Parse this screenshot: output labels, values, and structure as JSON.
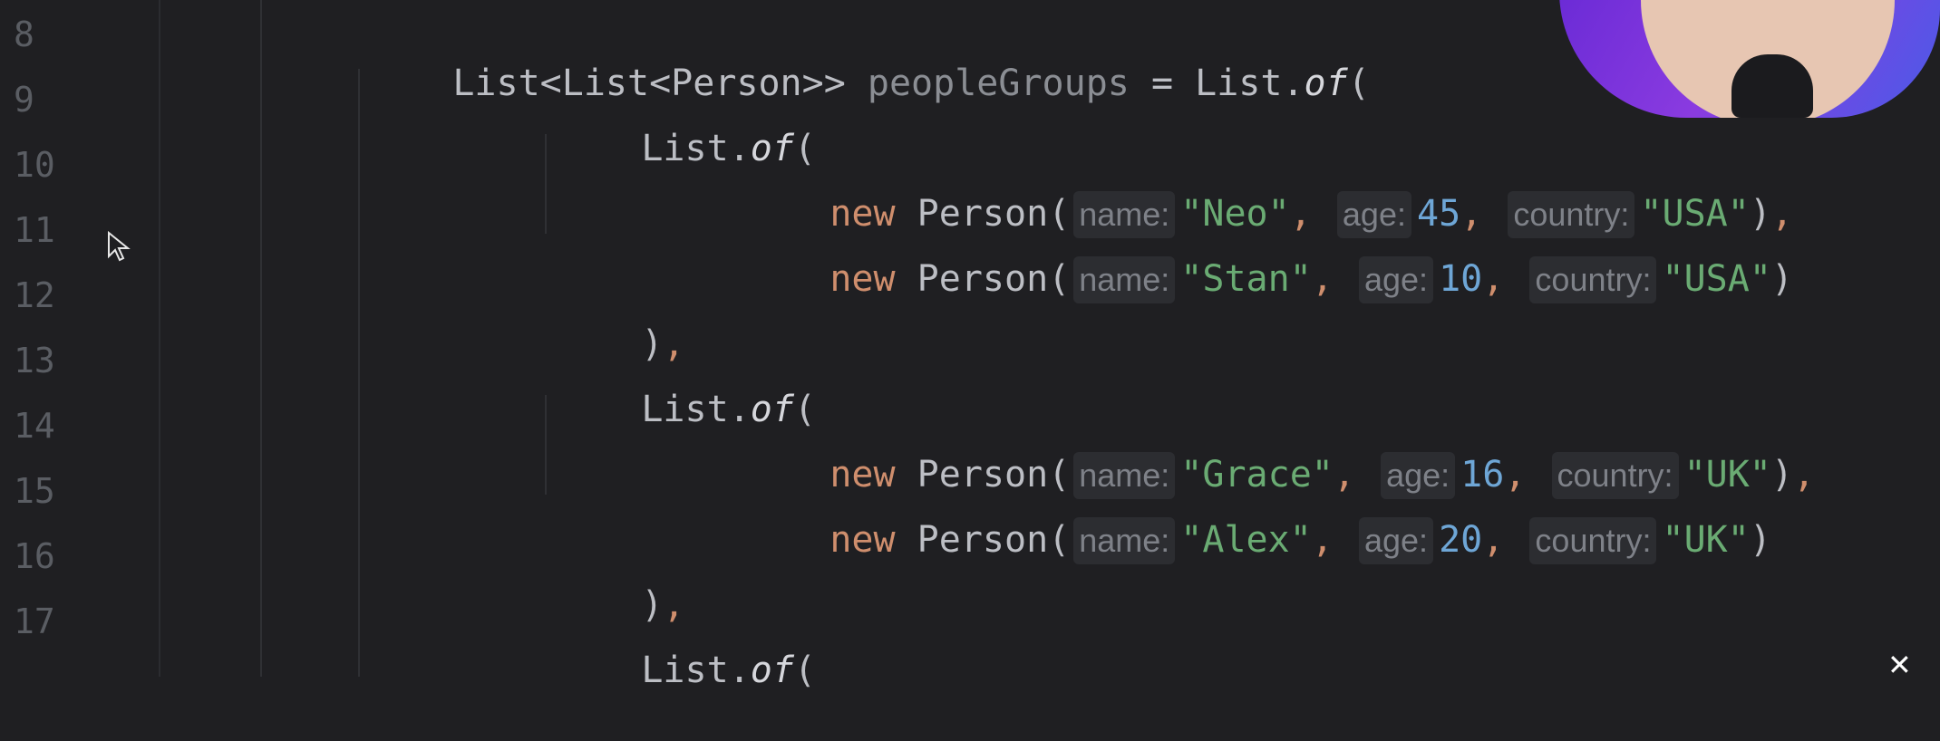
{
  "gutter": {
    "line_numbers": [
      "8",
      "9",
      "10",
      "11",
      "12",
      "13",
      "14",
      "15",
      "16",
      "17"
    ]
  },
  "code": {
    "line8": {
      "t1": "List<List<Person>> ",
      "var": "peopleGroups",
      "t2": " = List.",
      "of": "of",
      "t3": "("
    },
    "line9": {
      "t1": "List.",
      "of": "of",
      "t2": "("
    },
    "line10": {
      "kw": "new",
      "cls": " Person(",
      "hint_name": "name:",
      "name": "\"Neo\"",
      "c1": ",",
      "hint_age": "age:",
      "age": "45",
      "c2": ",",
      "hint_country": "country:",
      "country": "\"USA\"",
      "end": ")",
      "endc": ","
    },
    "line11": {
      "kw": "new",
      "cls": " Person(",
      "hint_name": "name:",
      "name": "\"Stan\"",
      "c1": ",",
      "hint_age": "age:",
      "age": "10",
      "c2": ",",
      "hint_country": "country:",
      "country": "\"USA\"",
      "end": ")"
    },
    "line12": {
      "t1": ")",
      "c": ","
    },
    "line13": {
      "t1": "List.",
      "of": "of",
      "t2": "("
    },
    "line14": {
      "kw": "new",
      "cls": " Person(",
      "hint_name": "name:",
      "name": "\"Grace\"",
      "c1": ",",
      "hint_age": "age:",
      "age": "16",
      "c2": ",",
      "hint_country": "country:",
      "country": "\"UK\"",
      "end": ")",
      "endc": ","
    },
    "line15": {
      "kw": "new",
      "cls": " Person(",
      "hint_name": "name:",
      "name": "\"Alex\"",
      "c1": ",",
      "hint_age": "age:",
      "age": "20",
      "c2": ",",
      "hint_country": "country:",
      "country": "\"UK\"",
      "end": ")"
    },
    "line16": {
      "t1": ")",
      "c": ","
    },
    "line17": {
      "t1": "List.",
      "of": "of",
      "t2": "("
    }
  },
  "colors": {
    "background": "#1f1f22",
    "keyword": "#cf8e6d",
    "string": "#6aab73",
    "number": "#6ea6d6",
    "variable": "#8b8e94"
  },
  "icons": {
    "cursor": "mouse-pointer-icon",
    "avatar": "presenter-webcam",
    "close": "close-icon"
  }
}
